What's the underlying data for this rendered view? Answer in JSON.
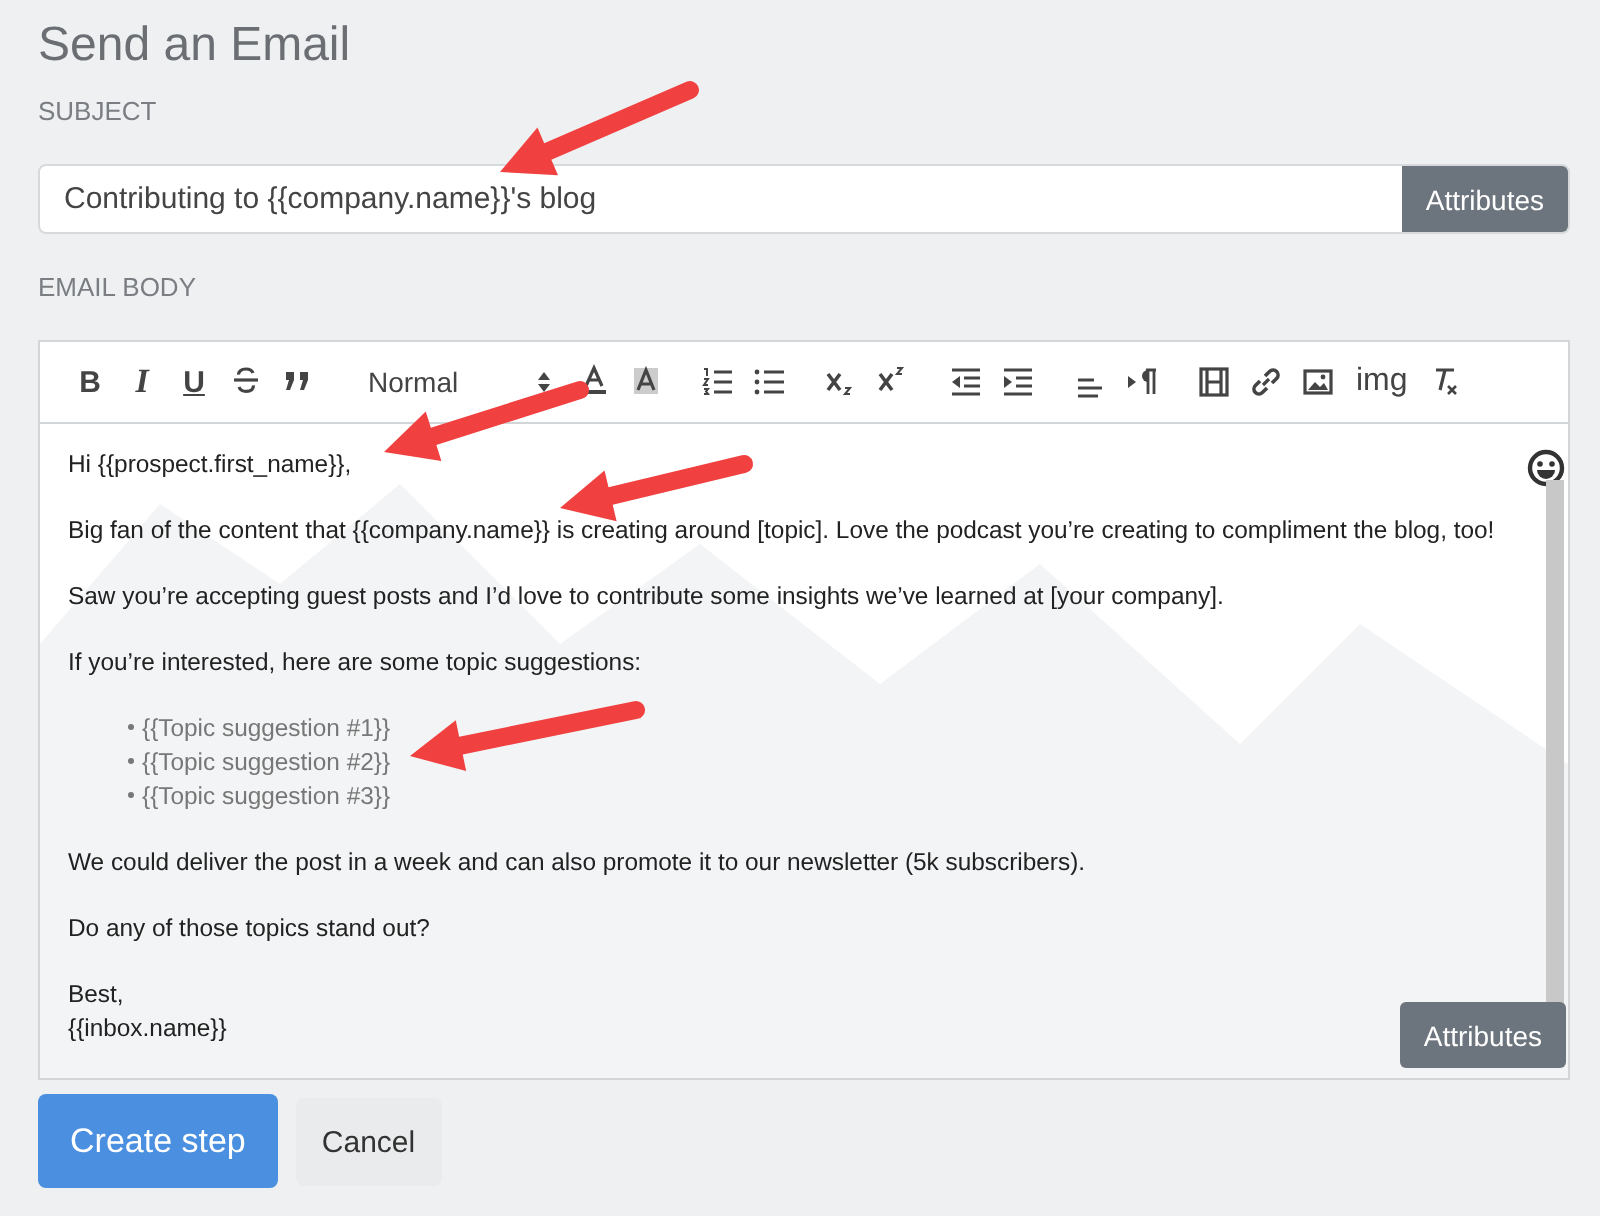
{
  "title": "Send an Email",
  "subject": {
    "label": "SUBJECT",
    "value": "Contributing to {{company.name}}'s blog",
    "button": "Attributes"
  },
  "body": {
    "label": "EMAIL BODY",
    "toolbar": [
      {
        "kind": "bold",
        "label": "B"
      },
      {
        "kind": "italic",
        "label": "I"
      },
      {
        "kind": "underline",
        "label": "U"
      },
      {
        "kind": "strike"
      },
      {
        "kind": "quote"
      },
      {
        "kind": "select",
        "label": "Normal"
      },
      {
        "kind": "color"
      },
      {
        "kind": "background"
      },
      {
        "kind": "ordered-list"
      },
      {
        "kind": "bullet-list"
      },
      {
        "kind": "subscript"
      },
      {
        "kind": "superscript"
      },
      {
        "kind": "outdent"
      },
      {
        "kind": "indent"
      },
      {
        "kind": "align"
      },
      {
        "kind": "direction"
      },
      {
        "kind": "video"
      },
      {
        "kind": "link"
      },
      {
        "kind": "image"
      },
      {
        "kind": "text",
        "label": "img"
      },
      {
        "kind": "clean"
      }
    ],
    "blocks": [
      {
        "kind": "paragraph",
        "lines": [
          "Hi {{prospect.first_name}},"
        ]
      },
      {
        "kind": "paragraph",
        "lines": [
          "Big fan of the content that {{company.name}} is creating around [topic]. Love the podcast you’re creating to compliment the blog, too!"
        ]
      },
      {
        "kind": "paragraph",
        "lines": [
          "Saw you’re accepting guest posts and I’d love to contribute some insights we’ve learned at [your company]."
        ]
      },
      {
        "kind": "paragraph",
        "lines": [
          "If you’re interested, here are some topic suggestions:"
        ]
      },
      {
        "kind": "list",
        "lines": [
          "{{Topic suggestion #1}}",
          "{{Topic suggestion #2}}",
          "{{Topic suggestion #3}}"
        ]
      },
      {
        "kind": "paragraph",
        "lines": [
          "We could deliver the post in a week and can also promote it to our newsletter (5k subscribers)."
        ]
      },
      {
        "kind": "paragraph",
        "lines": [
          "Do any of those topics stand out?"
        ]
      },
      {
        "kind": "paragraph",
        "lines": [
          "Best,",
          "{{inbox.name}}"
        ]
      }
    ],
    "button": "Attributes"
  },
  "actions": [
    {
      "kind": "primary",
      "label": "Create step"
    },
    {
      "kind": "secondary",
      "label": "Cancel"
    }
  ]
}
